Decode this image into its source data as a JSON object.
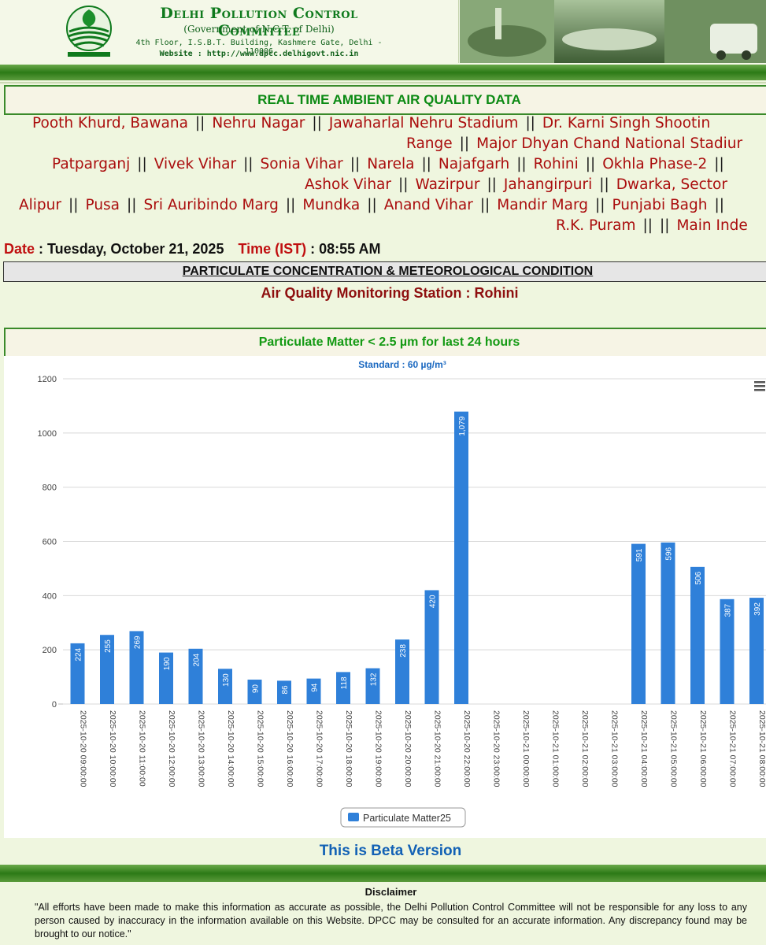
{
  "header": {
    "org_name": "Delhi Pollution Control Committee",
    "government": "(Government of N.C.T. of Delhi)",
    "address": "4th Floor, I.S.B.T. Building, Kashmere Gate, Delhi - 110006",
    "website": "Website : http://www.dpcc.delhigovt.nic.in"
  },
  "page_title": "REAL TIME AMBIENT AIR QUALITY DATA",
  "separator": "||",
  "station_lines": [
    [
      "Pooth Khurd, Bawana",
      "Nehru Nagar",
      "Jawaharlal Nehru Stadium",
      "Dr. Karni Singh Shootin"
    ],
    [
      "Range",
      "Major Dhyan Chand National Stadiur"
    ],
    [
      "Patparganj",
      "Vivek Vihar",
      "Sonia Vihar",
      "Narela",
      "Najafgarh",
      "Rohini",
      "Okhla Phase-2"
    ],
    [
      "Ashok Vihar",
      "Wazirpur",
      "Jahangirpuri",
      "Dwarka, Sector"
    ],
    [
      "Alipur",
      "Pusa",
      "Sri Auribindo Marg",
      "Mundka",
      "Anand Vihar",
      "Mandir Marg",
      "Punjabi Bagh"
    ],
    [
      "R.K. Puram",
      "",
      "Main Inde"
    ]
  ],
  "date_label": "Date",
  "date_value": " : Tuesday, October 21, 2025",
  "time_label": "Time (IST)",
  "time_value": " : 08:55 AM",
  "section_header": "PARTICULATE CONCENTRATION & METEOROLOGICAL CONDITION",
  "station_title": "Air Quality Monitoring Station : Rohini",
  "pm_title": "Particulate Matter < 2.5 µm for last 24 hours",
  "chart_data": {
    "type": "bar",
    "subtitle": "Standard : 60 µg/m³",
    "yticks": [
      "0",
      "200",
      "400",
      "600",
      "800",
      "1000",
      "1200"
    ],
    "ylim": [
      0,
      1200
    ],
    "grid": true,
    "legend_position": "bottom",
    "bar_color": "#2f80d9",
    "categories": [
      "2025-10-20 09:00:00",
      "2025-10-20 10:00:00",
      "2025-10-20 11:00:00",
      "2025-10-20 12:00:00",
      "2025-10-20 13:00:00",
      "2025-10-20 14:00:00",
      "2025-10-20 15:00:00",
      "2025-10-20 16:00:00",
      "2025-10-20 17:00:00",
      "2025-10-20 18:00:00",
      "2025-10-20 19:00:00",
      "2025-10-20 20:00:00",
      "2025-10-20 21:00:00",
      "2025-10-20 22:00:00",
      "2025-10-20 23:00:00",
      "2025-10-21 00:00:00",
      "2025-10-21 01:00:00",
      "2025-10-21 02:00:00",
      "2025-10-21 03:00:00",
      "2025-10-21 04:00:00",
      "2025-10-21 05:00:00",
      "2025-10-21 06:00:00",
      "2025-10-21 07:00:00",
      "2025-10-21 08:00:00"
    ],
    "series": [
      {
        "name": "Particulate Matter25",
        "values": [
          224,
          255,
          269,
          190,
          204,
          130,
          90,
          86,
          94,
          118,
          132,
          238,
          420,
          1079,
          null,
          null,
          null,
          null,
          null,
          591,
          596,
          506,
          387,
          392
        ],
        "labels": [
          "224",
          "255",
          "269",
          "190",
          "204",
          "130",
          "90",
          "86",
          "94",
          "118",
          "132",
          "238",
          "420",
          "1,079",
          "",
          "",
          "",
          "",
          "",
          "591",
          "596",
          "506",
          "387",
          "392"
        ]
      }
    ]
  },
  "menu_icon": "hamburger-menu-icon",
  "beta_text": "This is Beta Version",
  "disclaimer": {
    "title": "Disclaimer",
    "text": "\"All efforts have been made to make this information as accurate as possible, the Delhi Pollution Control Committee will not be responsible for any loss to any person caused by inaccuracy in the information available on this Website. DPCC may be consulted for an accurate information. Any discrepancy found may be brought to our notice.\""
  }
}
